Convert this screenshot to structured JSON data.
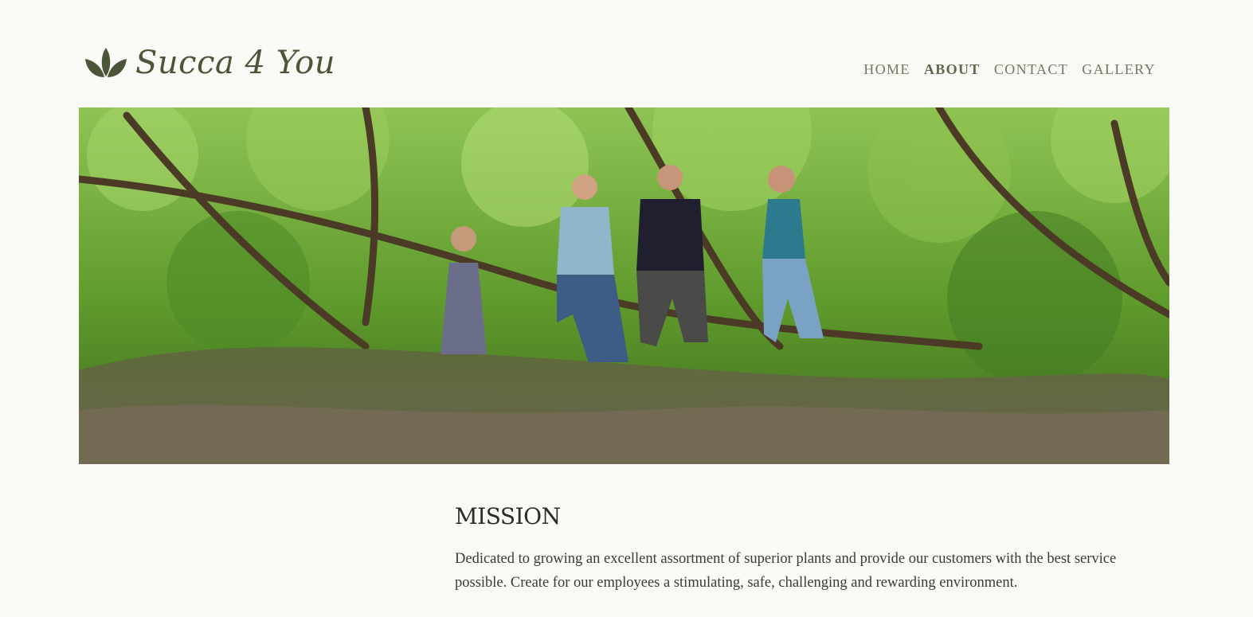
{
  "brand": {
    "name": "Succa 4 You",
    "logo_icon": "lotus-leaf-icon",
    "color": "#4a5637"
  },
  "nav": {
    "items": [
      {
        "label": "HOME",
        "active": false
      },
      {
        "label": "ABOUT",
        "active": true
      },
      {
        "label": "CONTACT",
        "active": false
      },
      {
        "label": "GALLERY",
        "active": false
      }
    ]
  },
  "hero": {
    "image_subject": "four-people-in-forest-photo"
  },
  "mission": {
    "heading": "MISSION",
    "text": "Dedicated to growing an excellent assortment of superior plants and provide our customers with the best service possible. Create for our employees a stimulating, safe, challenging and rewarding environment."
  },
  "colors": {
    "background": "#f9f9f5",
    "nav_text": "#6f7a62",
    "body_text": "#3a3a3a"
  }
}
